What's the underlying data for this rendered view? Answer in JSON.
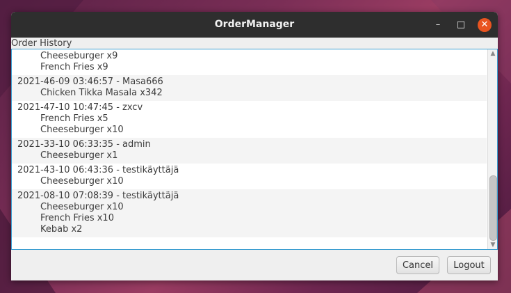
{
  "window": {
    "title": "OrderManager",
    "controls": {
      "minimize": "–",
      "maximize": "□",
      "close": "✕"
    }
  },
  "section_label": "Order History",
  "orders": [
    {
      "header": "",
      "items": [
        "Cheeseburger x9",
        "French Fries x9"
      ]
    },
    {
      "header": "2021-46-09 03:46:57 - Masa666",
      "items": [
        "Chicken Tikka Masala x342"
      ]
    },
    {
      "header": "2021-47-10 10:47:45 - zxcv",
      "items": [
        "French Fries x5",
        "Cheeseburger x10"
      ]
    },
    {
      "header": "2021-33-10 06:33:35 - admin",
      "items": [
        "Cheeseburger x1"
      ]
    },
    {
      "header": "2021-43-10 06:43:36 - testikäyttäjä",
      "items": [
        "Cheeseburger x10"
      ]
    },
    {
      "header": "2021-08-10 07:08:39 - testikäyttäjä",
      "items": [
        "Cheeseburger x10",
        "French Fries x10",
        "Kebab x2"
      ]
    }
  ],
  "scroll": {
    "up_arrow": "▲",
    "down_arrow": "▼",
    "position": 1.0
  },
  "buttons": {
    "cancel": "Cancel",
    "logout": "Logout"
  },
  "colors": {
    "titlebar": "#2e2e2e",
    "close_button": "#e95420",
    "list_focus_border": "#3d9fd1"
  }
}
